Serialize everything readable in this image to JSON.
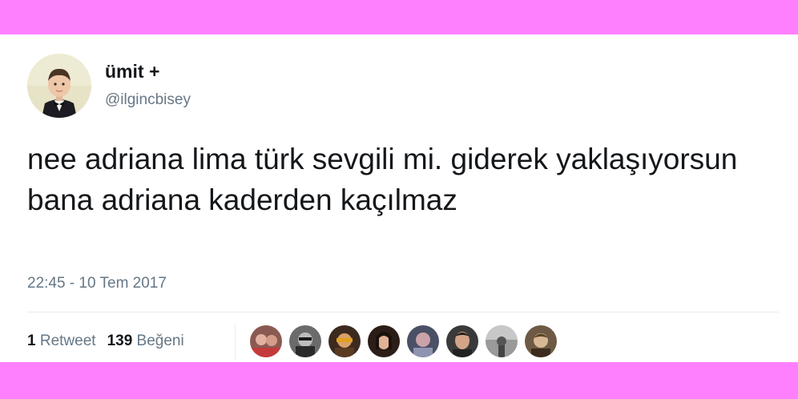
{
  "tweet": {
    "display_name": "ümit +",
    "handle": "@ilgincbisey",
    "text": "nee adriana lima türk sevgili mi. giderek yaklaşıyorsun bana adriana kaderden kaçılmaz",
    "timestamp": "22:45 - 10 Tem 2017"
  },
  "stats": {
    "retweet_count": "1",
    "retweet_label": "Retweet",
    "like_count": "139",
    "like_label": "Beğeni"
  },
  "likers": [
    {
      "name": "liker-1"
    },
    {
      "name": "liker-2"
    },
    {
      "name": "liker-3"
    },
    {
      "name": "liker-4"
    },
    {
      "name": "liker-5"
    },
    {
      "name": "liker-6"
    },
    {
      "name": "liker-7"
    },
    {
      "name": "liker-8"
    }
  ],
  "colors": {
    "frame": "#ff80ff",
    "card": "#ffffff",
    "text_primary": "#14171a",
    "text_secondary": "#657786",
    "divider": "#e6ecf0"
  }
}
